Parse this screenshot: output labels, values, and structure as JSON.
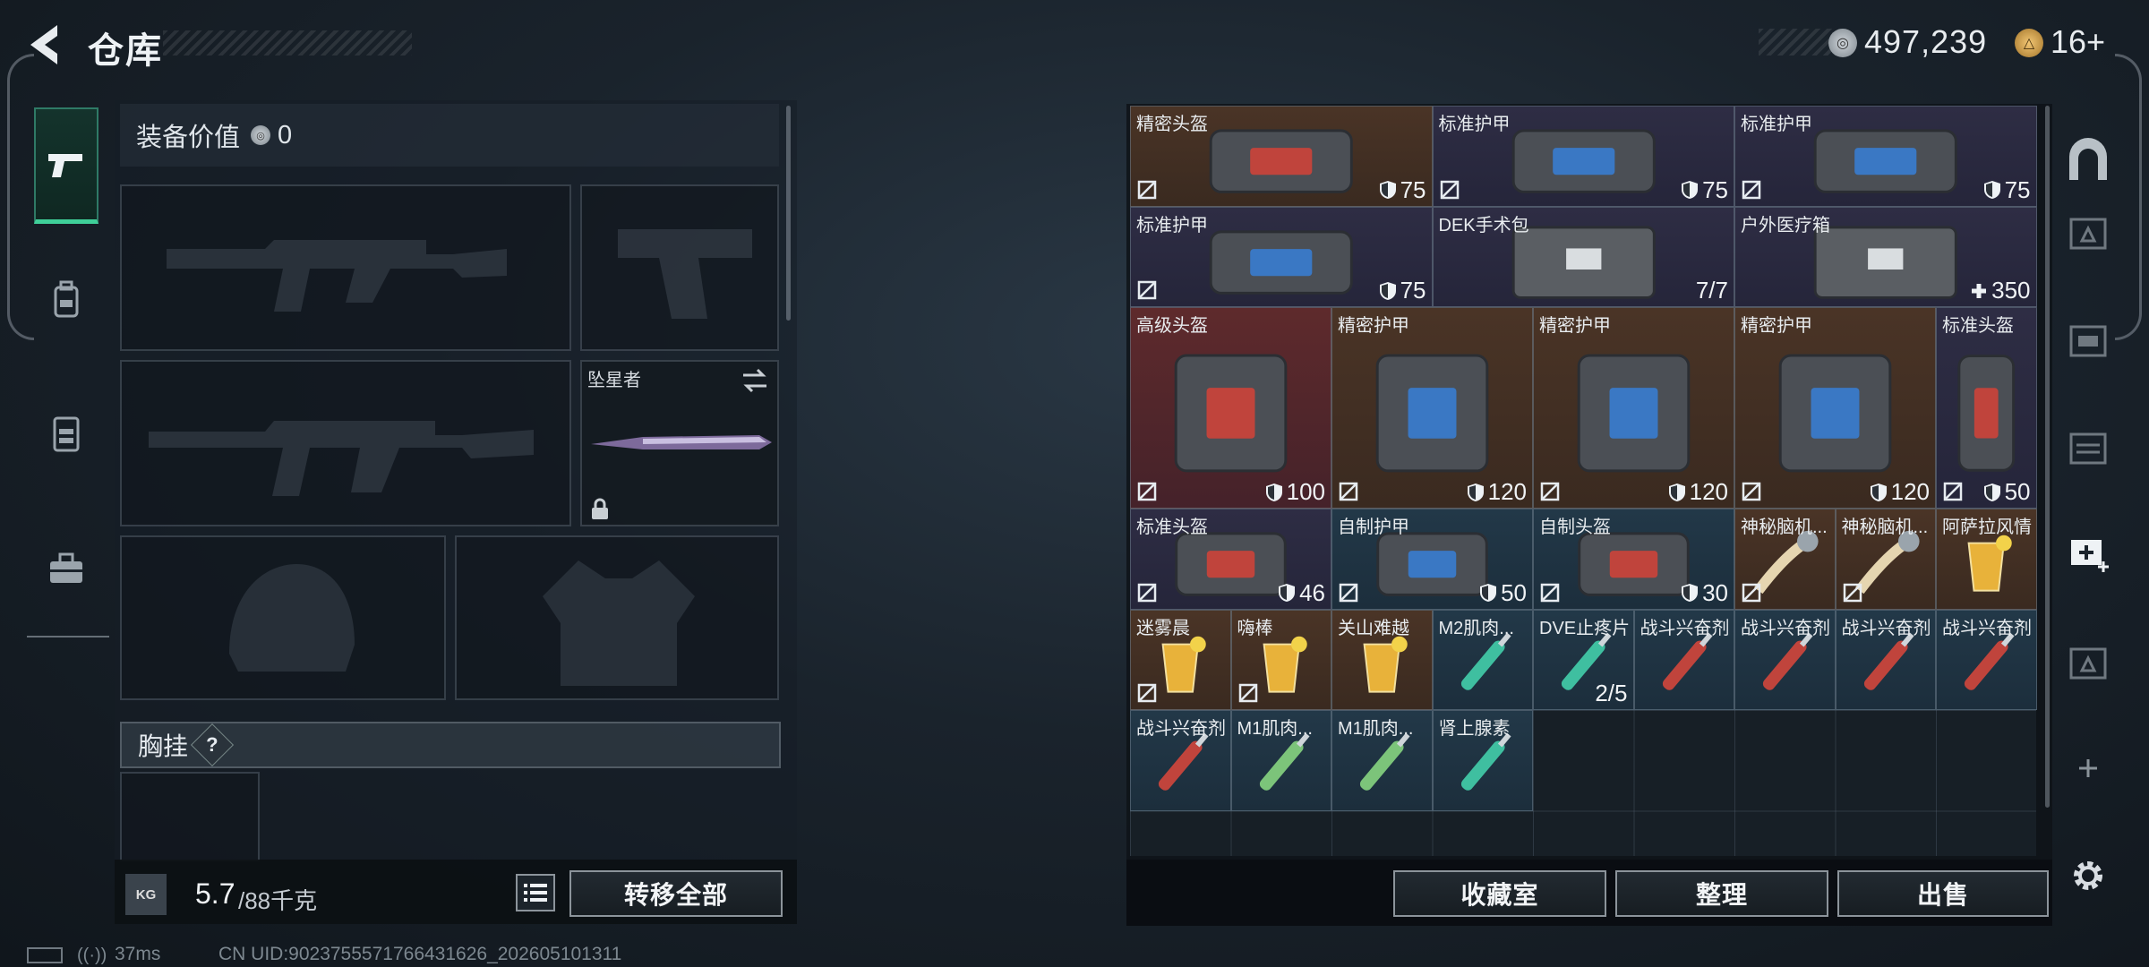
{
  "header": {
    "title": "仓库",
    "back_icon": "back-arrow-icon"
  },
  "currency": {
    "silver": "497,239",
    "gold": "16+"
  },
  "rail": {
    "items": [
      "pistol-icon",
      "backpack-icon",
      "rig-icon",
      "briefcase-icon"
    ],
    "active_index": 0
  },
  "equipment": {
    "value_label": "装备价值",
    "value": "0",
    "melee_name": "坠星者",
    "chest_label": "胸挂",
    "chest_help": "?",
    "weight_now": "5.7",
    "weight_max": "/88千克",
    "kg_label": "KG",
    "transfer_all": "转移全部"
  },
  "items": [
    {
      "name": "精密头盔",
      "value": "75",
      "kind": "armor",
      "rarity": "brown"
    },
    {
      "name": "标准护甲",
      "value": "75",
      "kind": "armor",
      "rarity": "purple"
    },
    {
      "name": "标准护甲",
      "value": "75",
      "kind": "armor",
      "rarity": "purple"
    },
    {
      "name": "标准护甲",
      "value": "75",
      "kind": "armor",
      "rarity": "purple"
    },
    {
      "name": "DEK手术包",
      "value": "7/7",
      "kind": "count",
      "rarity": "purple"
    },
    {
      "name": "户外医疗箱",
      "value": "350",
      "kind": "heal",
      "rarity": "purple"
    },
    {
      "name": "高级头盔",
      "value": "100",
      "kind": "armor",
      "rarity": "red"
    },
    {
      "name": "精密护甲",
      "value": "120",
      "kind": "armor",
      "rarity": "brown"
    },
    {
      "name": "精密护甲",
      "value": "120",
      "kind": "armor",
      "rarity": "brown"
    },
    {
      "name": "精密护甲",
      "value": "120",
      "kind": "armor",
      "rarity": "brown"
    },
    {
      "name": "标准头盔",
      "value": "50",
      "kind": "armor",
      "rarity": "purple"
    },
    {
      "name": "标准头盔",
      "value": "46",
      "kind": "armor",
      "rarity": "purple"
    },
    {
      "name": "自制护甲",
      "value": "50",
      "kind": "armor",
      "rarity": "blue"
    },
    {
      "name": "自制头盔",
      "value": "30",
      "kind": "armor",
      "rarity": "blue"
    },
    {
      "name": "神秘脑机...",
      "value": "",
      "kind": "none",
      "rarity": "brown"
    },
    {
      "name": "神秘脑机...",
      "value": "",
      "kind": "none",
      "rarity": "brown"
    },
    {
      "name": "阿萨拉风情",
      "value": "",
      "kind": "none",
      "rarity": "brown"
    },
    {
      "name": "迷雾晨",
      "value": "",
      "kind": "none",
      "rarity": "brown"
    },
    {
      "name": "嗨棒",
      "value": "",
      "kind": "none",
      "rarity": "brown"
    },
    {
      "name": "关山难越",
      "value": "",
      "kind": "none",
      "rarity": "brown"
    },
    {
      "name": "M2肌肉...",
      "value": "",
      "kind": "none",
      "rarity": "blue"
    },
    {
      "name": "DVE止疼片",
      "value": "2/5",
      "kind": "count",
      "rarity": "blue"
    },
    {
      "name": "战斗兴奋剂",
      "value": "",
      "kind": "none",
      "rarity": "blue"
    },
    {
      "name": "战斗兴奋剂",
      "value": "",
      "kind": "none",
      "rarity": "blue"
    },
    {
      "name": "战斗兴奋剂",
      "value": "",
      "kind": "none",
      "rarity": "blue"
    },
    {
      "name": "战斗兴奋剂",
      "value": "",
      "kind": "none",
      "rarity": "blue"
    },
    {
      "name": "战斗兴奋剂",
      "value": "",
      "kind": "none",
      "rarity": "blue"
    },
    {
      "name": "M1肌肉...",
      "value": "",
      "kind": "none",
      "rarity": "blue"
    },
    {
      "name": "M1肌肉...",
      "value": "",
      "kind": "none",
      "rarity": "blue"
    },
    {
      "name": "肾上腺素",
      "value": "",
      "kind": "none",
      "rarity": "blue"
    }
  ],
  "actions": {
    "collect": "收藏室",
    "sort": "整理",
    "sell": "出售"
  },
  "status": {
    "ping": "37ms",
    "uid": "CN UID:9023755571766431626_202605101311"
  },
  "colors": {
    "accent": "#3fcf99",
    "brown": "#4a3426",
    "purple": "#2e2d44",
    "red": "#5e2a2c",
    "blue": "#223848"
  }
}
